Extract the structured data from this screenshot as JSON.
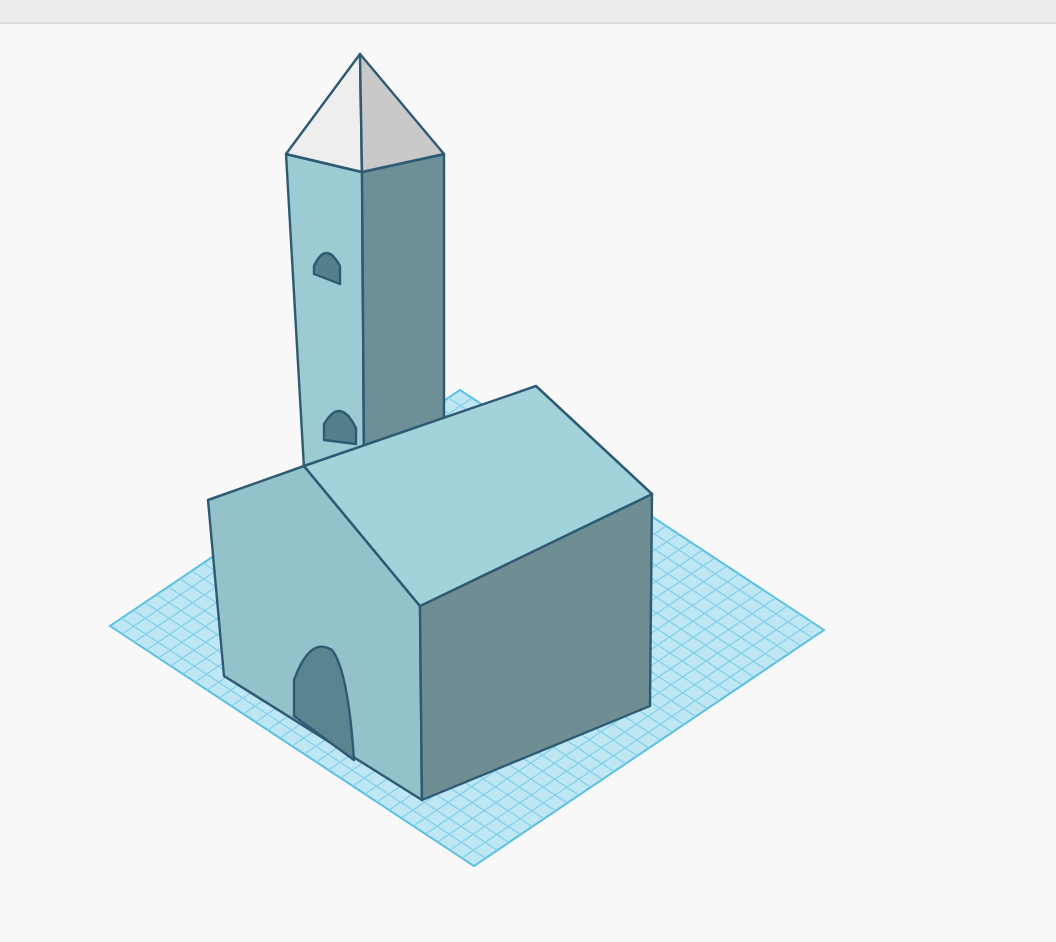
{
  "scene": {
    "kind": "church-model"
  }
}
